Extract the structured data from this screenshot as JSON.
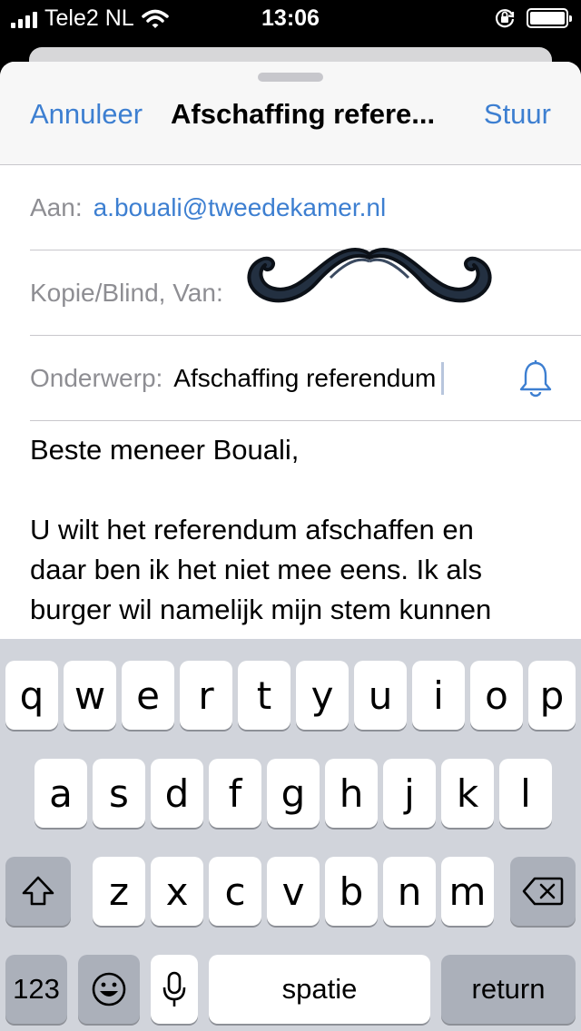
{
  "status_bar": {
    "carrier": "Tele2 NL",
    "time": "13:06",
    "icons": [
      "signal-icon",
      "wifi-icon",
      "orientation-lock-icon",
      "battery-icon"
    ]
  },
  "compose": {
    "cancel_label": "Annuleer",
    "title": "Afschaffing refere...",
    "send_label": "Stuur",
    "to_label": "Aan:",
    "to_value": "a.bouali@tweedekamer.nl",
    "cc_label": "Kopie/Blind, Van:",
    "subject_label": "Onderwerp:",
    "subject_value": "Afschaffing referendum",
    "body_lines": [
      "Beste meneer Bouali,",
      "",
      "U wilt het referendum afschaffen en",
      "daar ben ik het niet mee eens. Ik als",
      "burger wil namelijk mijn stem kunnen"
    ]
  },
  "colors": {
    "accent": "#3D7FD1",
    "label_gray": "#8E8E93",
    "keyboard_bg": "#D1D4DB",
    "key_dark": "#ABB0BA"
  },
  "keyboard": {
    "row1": [
      "q",
      "w",
      "e",
      "r",
      "t",
      "y",
      "u",
      "i",
      "o",
      "p"
    ],
    "row2": [
      "a",
      "s",
      "d",
      "f",
      "g",
      "h",
      "j",
      "k",
      "l"
    ],
    "row3": [
      "z",
      "x",
      "c",
      "v",
      "b",
      "n",
      "m"
    ],
    "numbers_label": "123",
    "space_label": "spatie",
    "return_label": "return"
  }
}
